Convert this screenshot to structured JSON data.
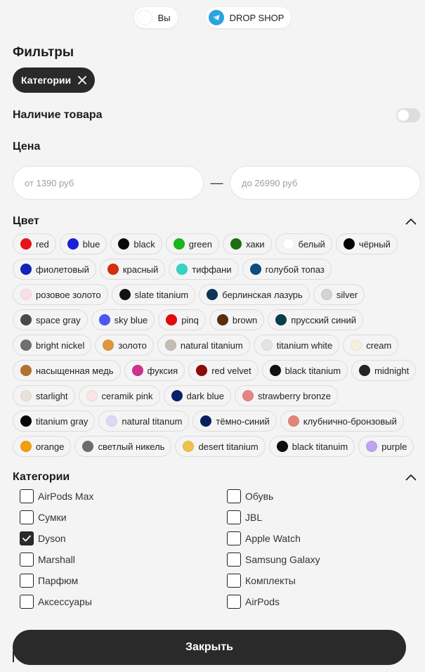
{
  "topbar": {
    "user_label": "Вы",
    "shop_label": "DROP SHOP"
  },
  "filters": {
    "title": "Фильтры",
    "active_chip": "Категории"
  },
  "stock": {
    "label": "Наличие товара",
    "enabled": false
  },
  "price": {
    "title": "Цена",
    "from_placeholder": "от 1390 руб",
    "to_placeholder": "до 26990 руб",
    "separator": "—"
  },
  "colors": {
    "title": "Цвет",
    "items": [
      {
        "label": "red",
        "color": "#e8121b"
      },
      {
        "label": "blue",
        "color": "#1b1fd8"
      },
      {
        "label": "black",
        "color": "#0a0a0a"
      },
      {
        "label": "green",
        "color": "#17b71b"
      },
      {
        "label": "хаки",
        "color": "#1e6e12"
      },
      {
        "label": "белый",
        "color": "#ffffff"
      },
      {
        "label": "чёрный",
        "color": "#050505"
      },
      {
        "label": "фиолетовый",
        "color": "#1024b8"
      },
      {
        "label": "красный",
        "color": "#d4300c"
      },
      {
        "label": "тиффани",
        "color": "#36d2c4"
      },
      {
        "label": "голубой топаз",
        "color": "#0b4d80"
      },
      {
        "label": "розовое золото",
        "color": "#fbdfe4"
      },
      {
        "label": "slate titanium",
        "color": "#111511"
      },
      {
        "label": "берлинская лазурь",
        "color": "#0b3459"
      },
      {
        "label": "silver",
        "color": "#d3d3d3"
      },
      {
        "label": "space gray",
        "color": "#4a4a4a"
      },
      {
        "label": "sky blue",
        "color": "#4a58f4"
      },
      {
        "label": "pinq",
        "color": "#e6080e"
      },
      {
        "label": "brown",
        "color": "#5a2e0c"
      },
      {
        "label": "прусский синий",
        "color": "#083e4e"
      },
      {
        "label": "bright nickel",
        "color": "#707070"
      },
      {
        "label": "золото",
        "color": "#e1963c"
      },
      {
        "label": "natural titanium",
        "color": "#c3bdb4"
      },
      {
        "label": "titanium white",
        "color": "#e4e4e4"
      },
      {
        "label": "cream",
        "color": "#f3f0e0"
      },
      {
        "label": "насыщенная медь",
        "color": "#b3722c"
      },
      {
        "label": "фуксия",
        "color": "#d0308e"
      },
      {
        "label": "red velvet",
        "color": "#8e0b0b"
      },
      {
        "label": "black titanium",
        "color": "#111111"
      },
      {
        "label": "midnight",
        "color": "#222428"
      },
      {
        "label": "starlight",
        "color": "#e9e2d8"
      },
      {
        "label": "ceramik pink",
        "color": "#fbe3e6"
      },
      {
        "label": "dark blue",
        "color": "#0a1f6a"
      },
      {
        "label": "strawberry bronze",
        "color": "#e58480"
      },
      {
        "label": "titanium gray",
        "color": "#060606"
      },
      {
        "label": "natural titanum",
        "color": "#dcd9f6"
      },
      {
        "label": "тёмно-синий",
        "color": "#0b1f5e"
      },
      {
        "label": "клубнично-бронзовый",
        "color": "#e08778"
      },
      {
        "label": "orange",
        "color": "#f49e0c"
      },
      {
        "label": "светлый никель",
        "color": "#6c6c6c"
      },
      {
        "label": "desert titanium",
        "color": "#ecc24a"
      },
      {
        "label": "black titanuim",
        "color": "#0e0e0e"
      },
      {
        "label": "purple",
        "color": "#bea3ef"
      }
    ]
  },
  "categories": {
    "title": "Категории",
    "items": [
      {
        "label": "AirPods Max",
        "checked": false
      },
      {
        "label": "Обувь",
        "checked": false
      },
      {
        "label": "Сумки",
        "checked": false
      },
      {
        "label": "JBL",
        "checked": false
      },
      {
        "label": "Dyson",
        "checked": true
      },
      {
        "label": "Apple Watch",
        "checked": false
      },
      {
        "label": "Marshall",
        "checked": false
      },
      {
        "label": "Samsung Galaxy",
        "checked": false
      },
      {
        "label": "Парфюм",
        "checked": false
      },
      {
        "label": "Комплекты",
        "checked": false
      },
      {
        "label": "Аксессуары",
        "checked": false
      },
      {
        "label": "AirPods",
        "checked": false
      }
    ]
  },
  "footer": {
    "close_label": "Закрыть"
  }
}
